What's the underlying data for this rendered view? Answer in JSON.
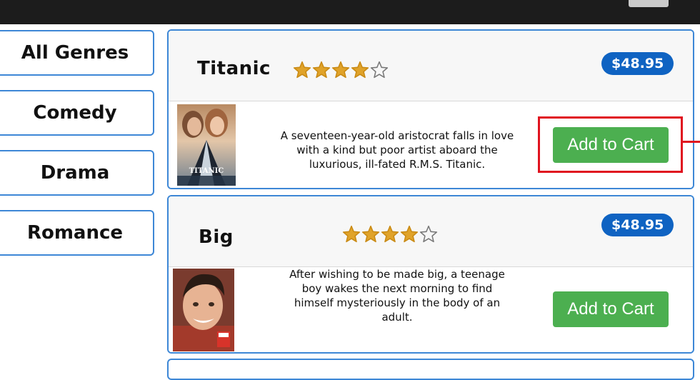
{
  "sidebar": {
    "genres": [
      {
        "label": "All Genres"
      },
      {
        "label": "Comedy"
      },
      {
        "label": "Drama"
      },
      {
        "label": "Romance"
      }
    ]
  },
  "movies": [
    {
      "title": "Titanic",
      "rating": 4,
      "rating_max": 5,
      "price": "$48.95",
      "poster_text": "TITANIC",
      "description_lines": [
        "A seventeen-year-old aristocrat falls in love",
        "with a kind but poor artist aboard the",
        "luxurious, ill-fated R.M.S. Titanic."
      ],
      "cart_label": "Add to Cart"
    },
    {
      "title": "Big",
      "rating": 4,
      "rating_max": 5,
      "price": "$48.95",
      "description_lines": [
        "After wishing to be made big, a teenage",
        "boy wakes the next morning to find",
        "himself mysteriously in the body of an",
        "adult."
      ],
      "cart_label": "Add to Cart"
    }
  ],
  "colors": {
    "accent_border": "#3d87d6",
    "price_badge": "#0f63c2",
    "cart_button": "#4caf50",
    "star_filled": "#e0a32a",
    "highlight": "#e0131f",
    "topbar": "#1c1c1c"
  },
  "icons": {
    "star_filled": "star-filled-icon",
    "star_empty": "star-outline-icon"
  }
}
